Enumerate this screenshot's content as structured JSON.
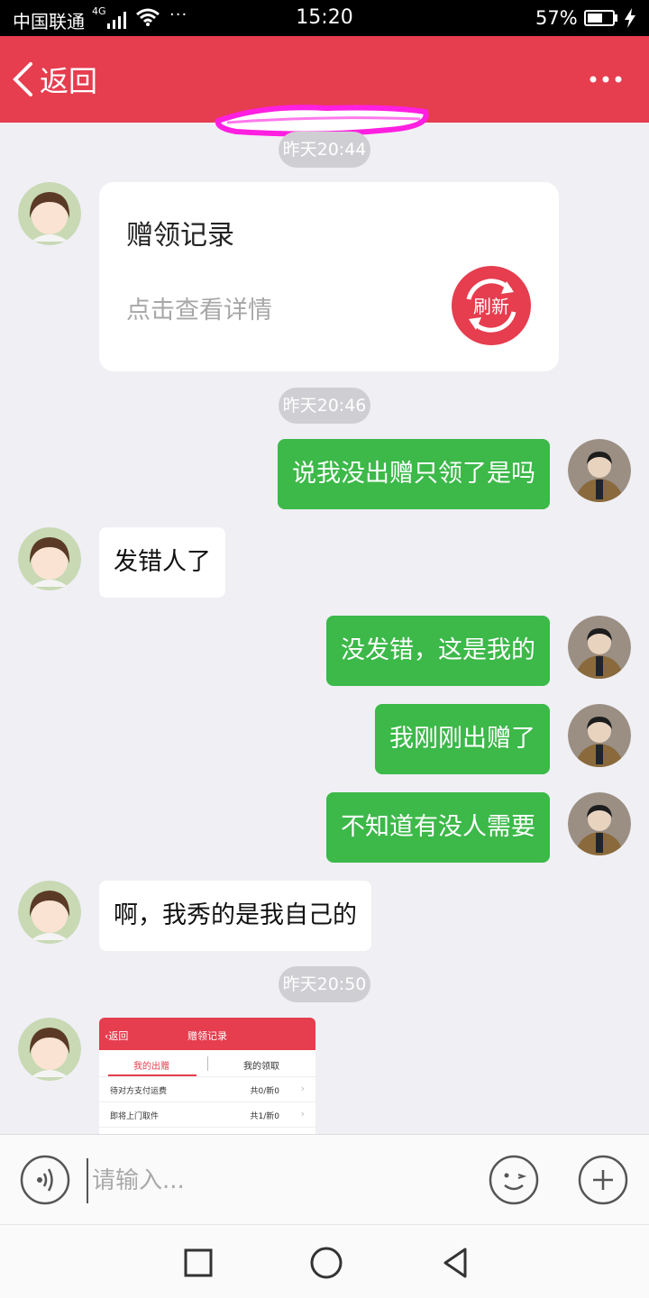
{
  "status_bar": {
    "carrier": "中国联通",
    "network": "4G",
    "more": "···",
    "time": "15:20",
    "battery": "57%"
  },
  "nav": {
    "back_label": "返回",
    "title_redacted": true
  },
  "colors": {
    "accent": "#e63d4f",
    "outgoing_bubble": "#3cb949",
    "incoming_bubble": "#ffffff",
    "background": "#efeff4",
    "redaction_scribble": "#ff1fe0"
  },
  "messages": [
    {
      "type": "timestamp",
      "text": "昨天20:44"
    },
    {
      "type": "card",
      "sender": "other",
      "title": "赠领记录",
      "subtitle": "点击查看详情",
      "icon": "refresh-icon",
      "icon_label": "刷新"
    },
    {
      "type": "timestamp",
      "text": "昨天20:46"
    },
    {
      "type": "text",
      "sender": "me",
      "text": "说我没出赠只领了是吗"
    },
    {
      "type": "text",
      "sender": "other",
      "text": "发错人了"
    },
    {
      "type": "text",
      "sender": "me",
      "text": "没发错，这是我的"
    },
    {
      "type": "text",
      "sender": "me",
      "text": "我刚刚出赠了"
    },
    {
      "type": "text",
      "sender": "me",
      "text": "不知道有没人需要"
    },
    {
      "type": "text",
      "sender": "other",
      "text": "啊，我秀的是我自己的"
    },
    {
      "type": "timestamp",
      "text": "昨天20:50"
    },
    {
      "type": "image",
      "sender": "other",
      "image": {
        "back": "返回",
        "title": "赠领记录",
        "tabs": [
          "我的出赠",
          "我的领取"
        ],
        "rows": [
          {
            "label": "待对方支付运费",
            "value": "共0/新0"
          },
          {
            "label": "即将上门取件",
            "value": "共1/新0"
          }
        ]
      }
    }
  ],
  "input": {
    "placeholder": "请输入...",
    "value": "",
    "left_icon": "voice-icon",
    "right_icons": [
      "emoji-icon",
      "plus-icon"
    ]
  },
  "system_nav": [
    "square-icon",
    "circle-icon",
    "triangle-back-icon"
  ]
}
